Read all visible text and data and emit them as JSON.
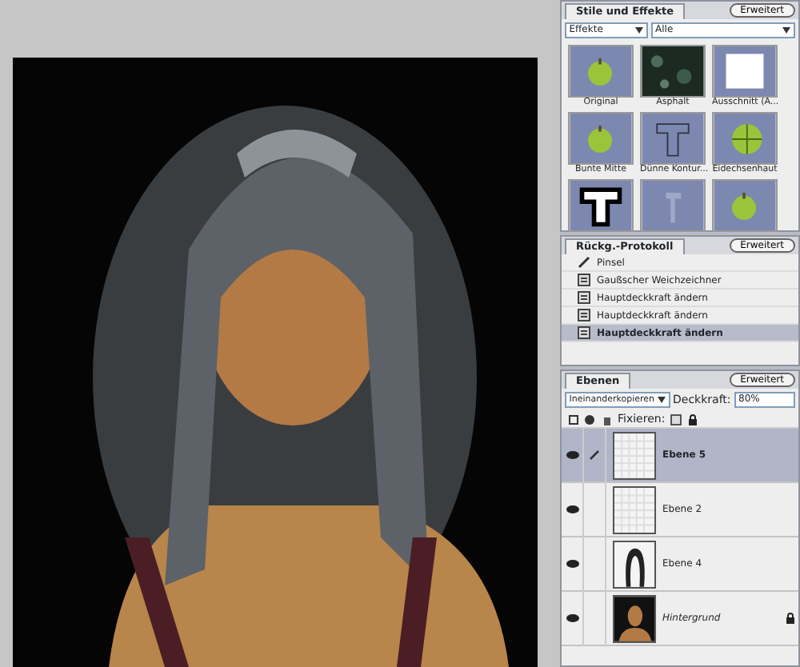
{
  "styles_panel": {
    "tab": "Stile und Effekte",
    "menu_button": "Erweitert",
    "category": "Effekte",
    "filter": "Alle",
    "items": [
      {
        "label": "Original",
        "kind": "apple"
      },
      {
        "label": "Asphalt",
        "kind": "texture"
      },
      {
        "label": "Ausschnitt (A...",
        "kind": "frame"
      },
      {
        "label": "Bunte Mitte",
        "kind": "apple"
      },
      {
        "label": "Dünne Kontur...",
        "kind": "text"
      },
      {
        "label": "Eidechsenhaut",
        "kind": "scales"
      },
      {
        "kind": "boldtext"
      },
      {
        "kind": "ghost"
      },
      {
        "kind": "apple"
      }
    ]
  },
  "history_panel": {
    "tab": "Rückg.-Protokoll",
    "menu_button": "Erweitert",
    "items": [
      {
        "label": "Pinsel",
        "kind": "brush",
        "selected": false
      },
      {
        "label": "Gaußscher Weichzeichner",
        "kind": "doc",
        "selected": false
      },
      {
        "label": "Hauptdeckkraft ändern",
        "kind": "doc",
        "selected": false
      },
      {
        "label": "Hauptdeckkraft ändern",
        "kind": "doc",
        "selected": false
      },
      {
        "label": "Hauptdeckkraft ändern",
        "kind": "doc",
        "selected": true
      }
    ]
  },
  "layers_panel": {
    "tab": "Ebenen",
    "menu_button": "Erweitert",
    "blend_mode": "Ineinanderkopieren",
    "opacity_label": "Deckkraft:",
    "opacity": "80%",
    "lock_label": "Fixieren:",
    "layers": [
      {
        "name": "Ebene 5",
        "kind": "empty",
        "visible": true,
        "selected": true,
        "locked": false
      },
      {
        "name": "Ebene 2",
        "kind": "empty",
        "visible": true,
        "selected": false,
        "locked": false
      },
      {
        "name": "Ebene 4",
        "kind": "hair",
        "visible": true,
        "selected": false,
        "locked": false
      },
      {
        "name": "Hintergrund",
        "visible": true,
        "selected": false,
        "locked": true
      }
    ]
  }
}
